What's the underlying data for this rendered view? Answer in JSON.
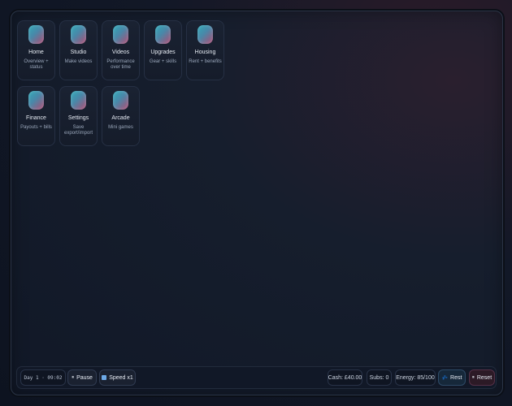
{
  "apps": [
    {
      "title": "Home",
      "subtitle": "Overview + status",
      "icon": "home-icon"
    },
    {
      "title": "Studio",
      "subtitle": "Make videos",
      "icon": "studio-icon"
    },
    {
      "title": "Videos",
      "subtitle": "Performance over time",
      "icon": "videos-icon"
    },
    {
      "title": "Upgrades",
      "subtitle": "Gear + skills",
      "icon": "upgrades-icon"
    },
    {
      "title": "Housing",
      "subtitle": "Rent + benefits",
      "icon": "housing-icon"
    },
    {
      "title": "Finance",
      "subtitle": "Payouts + bills",
      "icon": "finance-icon"
    },
    {
      "title": "Settings",
      "subtitle": "Save export/import",
      "icon": "settings-icon"
    },
    {
      "title": "Arcade",
      "subtitle": "Mini games",
      "icon": "arcade-icon"
    }
  ],
  "statusbar": {
    "clock": "Day 1 · 09:02",
    "pause_label": "Pause",
    "pause_glyph": "⏸",
    "speed_label": "Speed x1",
    "cash": "Cash: £40.00",
    "subs": "Subs: 0",
    "energy": "Energy: 85/100",
    "rest_label": "Rest",
    "rest_glyph": "💤",
    "reset_label": "Reset",
    "reset_glyph": "⏸"
  },
  "colors": {
    "accent_teal": "#2fa9b8",
    "accent_pink": "#b04a72",
    "background": "#111827"
  }
}
